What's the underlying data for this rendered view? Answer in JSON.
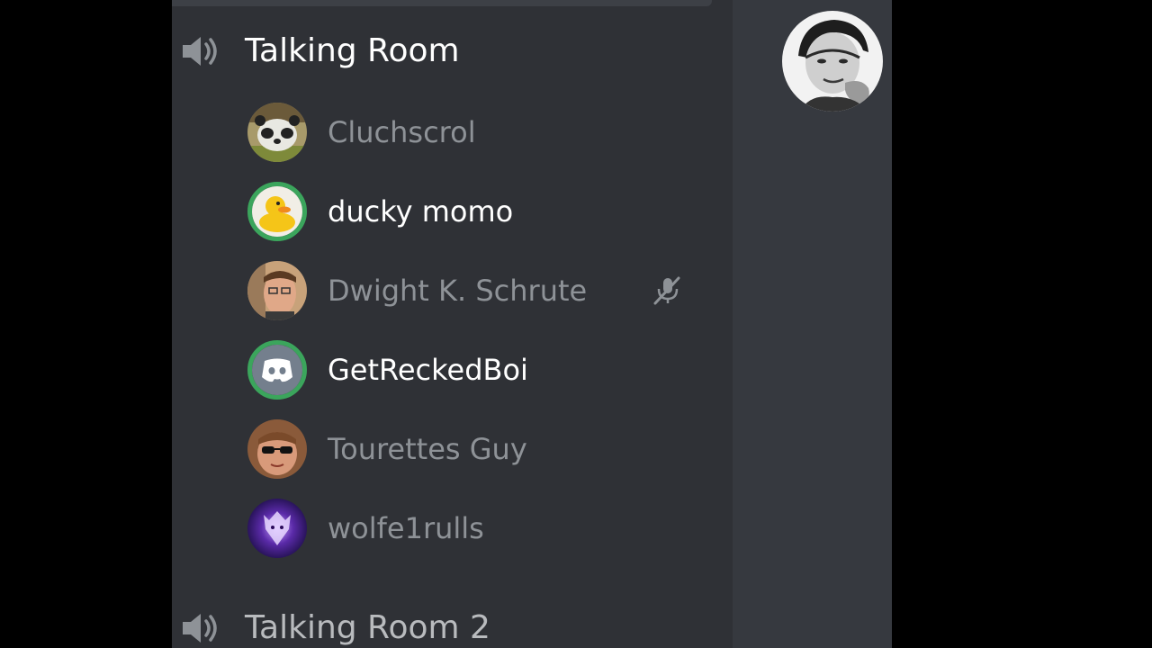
{
  "voice_channels": [
    {
      "name": "Talking Room",
      "icon": "speaker-icon"
    },
    {
      "name": "Talking Room 2",
      "icon": "speaker-icon"
    }
  ],
  "members": [
    {
      "name": "Cluchscrol",
      "avatar": "panda-avatar",
      "speaking": false
    },
    {
      "name": "ducky momo",
      "avatar": "rubber-duck-avatar",
      "speaking": true
    },
    {
      "name": "Dwight K. Schrute",
      "avatar": "man-with-glasses-avatar",
      "speaking": false,
      "muted": true
    },
    {
      "name": "GetReckedBoi",
      "avatar": "discord-default-avatar",
      "speaking": true
    },
    {
      "name": "Tourettes Guy",
      "avatar": "man-with-sunglasses-avatar",
      "speaking": false
    },
    {
      "name": "wolfe1rulls",
      "avatar": "purple-wolf-avatar",
      "speaking": false
    }
  ],
  "current_user": {
    "avatar": "black-and-white-portrait-avatar"
  },
  "colors": {
    "channel_bg": "#2f3136",
    "right_panel_bg": "#36393f",
    "speaking_ring": "#3ba55c",
    "text_bright": "#ffffff",
    "text_dim": "#8e9297",
    "icon_gray": "#8e9297"
  }
}
